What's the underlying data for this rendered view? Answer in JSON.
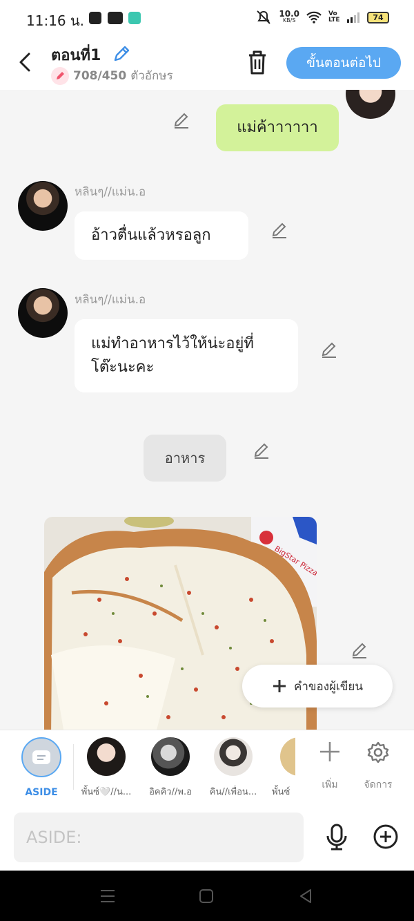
{
  "status_bar": {
    "time": "11:16 น.",
    "net_speed_value": "10.0",
    "net_speed_unit": "KB/S",
    "volte": "Vo LTE",
    "battery": "74"
  },
  "header": {
    "title": "ตอนที่1",
    "char_count": "708/450",
    "char_unit": "ตัวอักษร",
    "next_label": "ขั้นตอนต่อไป"
  },
  "messages": {
    "m1_text": "แม่ค้าาาาาา",
    "m2_sender": "หลินๆ//แม่น.อ",
    "m2_text": "อ้าวตื่นแล้วหรอลูก",
    "m3_sender": "หลินๆ//แม่น.อ",
    "m3_line1": "แม่ทำอาหารไว้ให้น่ะอยู่ที่",
    "m3_line2": "โต๊ะนะคะ",
    "m4_text": "อาหาร",
    "photo_brand": "BigStar Pizza"
  },
  "add_note_label": "คำของผู้เขียน",
  "characters": [
    {
      "label": "ASIDE"
    },
    {
      "label": "พั้นซ์🤍//น..."
    },
    {
      "label": "อิคคิว//พ.อ"
    },
    {
      "label": "คิน//เพื่อน..."
    },
    {
      "label": "พั้นซ์"
    }
  ],
  "tools": {
    "add_label": "เพิ่ม",
    "manage_label": "จัดการ"
  },
  "input": {
    "placeholder": "ASIDE:"
  },
  "colors": {
    "accent": "#5aa8f2",
    "my_bubble": "#d3f29a",
    "bg": "#f5f5f5"
  }
}
